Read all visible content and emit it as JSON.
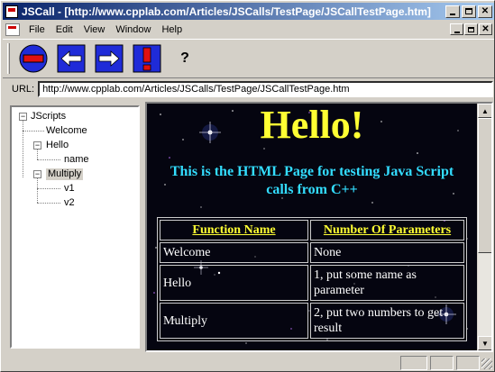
{
  "window": {
    "title": "JSCall - [http://www.cpplab.com/Articles/JSCalls/TestPage/JSCallTestPage.htm]"
  },
  "menu": [
    {
      "label": "File",
      "key": "F"
    },
    {
      "label": "Edit",
      "key": "E"
    },
    {
      "label": "View",
      "key": "V"
    },
    {
      "label": "Window",
      "key": "W"
    },
    {
      "label": "Help",
      "key": "H"
    }
  ],
  "toolbar": {
    "stop_icon": "stop-icon",
    "back_icon": "back-arrow-icon",
    "forward_icon": "forward-arrow-icon",
    "alert_icon": "exclamation-icon",
    "help_icon": "help-icon",
    "help_glyph": "?"
  },
  "url": {
    "label": "URL:",
    "value": "http://www.cpplab.com/Articles/JSCalls/TestPage/JSCallTestPage.htm"
  },
  "tree": {
    "root": "JScripts",
    "items": [
      {
        "label": "Welcome"
      },
      {
        "label": "Hello",
        "children": [
          "name"
        ]
      },
      {
        "label": "Multiply",
        "children": [
          "v1",
          "v2"
        ],
        "selected": true
      }
    ]
  },
  "page": {
    "title": "Hello!",
    "subtitle": "This is the HTML Page for testing Java Script calls from C++",
    "table": {
      "headers": [
        "Function Name",
        "Number Of Parameters"
      ],
      "rows": [
        [
          "Welcome",
          "None"
        ],
        [
          "Hello",
          "1, put some name as parameter"
        ],
        [
          "Multiply",
          "2, put two numbers to get result"
        ]
      ]
    }
  },
  "colors": {
    "titlebar_start": "#0a246a",
    "titlebar_end": "#a6caf0",
    "page_title": "#ffff33",
    "page_subtitle": "#33ddff",
    "toolbar_icon_blue": "#1f2bd8",
    "toolbar_icon_red": "#e01010"
  }
}
